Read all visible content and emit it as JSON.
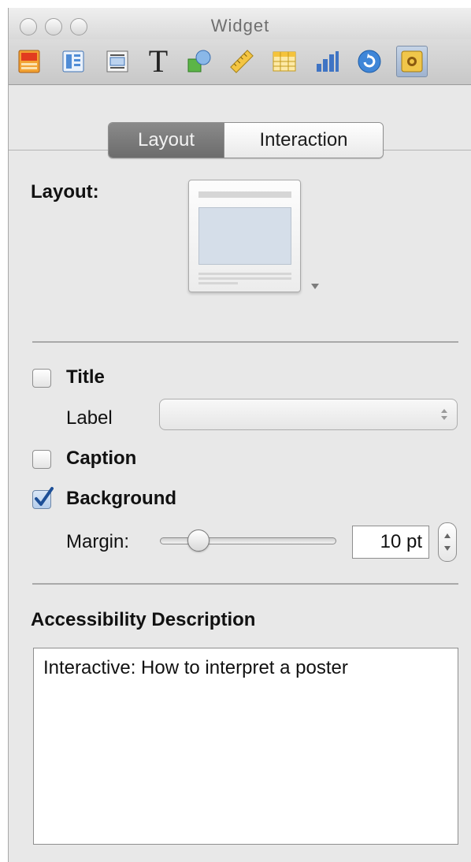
{
  "window": {
    "title": "Widget"
  },
  "toolbar": {
    "tools": [
      {
        "icon": "document-icon"
      },
      {
        "icon": "layout-icon"
      },
      {
        "icon": "wrap-icon"
      },
      {
        "icon": "text-icon",
        "glyph": "T"
      },
      {
        "icon": "shapes-icon"
      },
      {
        "icon": "ruler-icon"
      },
      {
        "icon": "table-icon"
      },
      {
        "icon": "chart-icon"
      },
      {
        "icon": "link-icon"
      },
      {
        "icon": "widget-icon",
        "active": true
      }
    ]
  },
  "tabs": {
    "layout": "Layout",
    "interaction": "Interaction",
    "selected": "layout"
  },
  "layout": {
    "label": "Layout:"
  },
  "title_option": {
    "label": "Title",
    "checked": false,
    "sublabel": "Label",
    "popup_value": ""
  },
  "caption_option": {
    "label": "Caption",
    "checked": false
  },
  "background_option": {
    "label": "Background",
    "checked": true,
    "margin_label": "Margin:",
    "margin_value": "10 pt",
    "margin_slider_fraction": 0.18
  },
  "accessibility": {
    "heading": "Accessibility Description",
    "text": "Interactive: How to interpret a poster"
  },
  "colors": {
    "accent": "#3f74c4",
    "checkmark": "#1d4f97"
  }
}
